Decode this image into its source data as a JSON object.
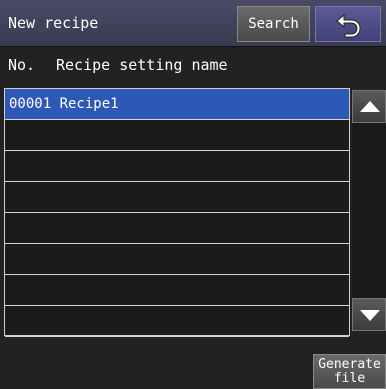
{
  "header": {
    "title": "New recipe",
    "search_label": "Search",
    "back_icon": "undo-arrow-icon"
  },
  "columns": {
    "no": "No.",
    "name": "Recipe setting name"
  },
  "list": {
    "rows": [
      {
        "text": "00001 Recipe1",
        "selected": true
      },
      {
        "text": ""
      },
      {
        "text": ""
      },
      {
        "text": ""
      },
      {
        "text": ""
      },
      {
        "text": ""
      },
      {
        "text": ""
      },
      {
        "text": ""
      }
    ]
  },
  "scroll": {
    "up_icon": "triangle-up-icon",
    "down_icon": "triangle-down-icon"
  },
  "footer": {
    "generate_label": "Generate\nfile"
  },
  "colors": {
    "background": "#222222",
    "selected_row": "#2e58b8",
    "back_button": "#4b4b88"
  }
}
